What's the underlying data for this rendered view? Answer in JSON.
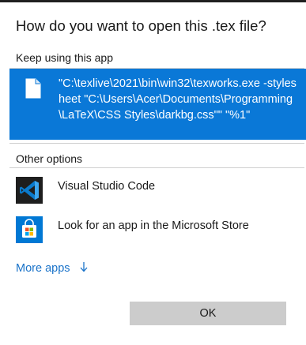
{
  "dialog": {
    "title": "How do you want to open this .tex file?"
  },
  "keep_section": {
    "header": "Keep using this app",
    "app": {
      "icon": "file-icon",
      "label": "\"C:\\texlive\\2021\\bin\\win32\\texworks.exe -stylesheet \"C:\\Users\\Acer\\Documents\\Programming\\LaTeX\\CSS Styles\\darkbg.css\"\" \"%1\""
    }
  },
  "other_section": {
    "header": "Other options",
    "apps": [
      {
        "icon": "vscode-icon",
        "label": "Visual Studio Code"
      },
      {
        "icon": "microsoft-store-icon",
        "label": "Look for an app in the Microsoft Store"
      }
    ]
  },
  "more_apps": {
    "label": "More apps",
    "icon": "arrow-down-icon"
  },
  "buttons": {
    "ok_label": "OK"
  },
  "colors": {
    "selection": "#0a78d7",
    "link": "#1a73c9",
    "button_bg": "#cccccc",
    "vscode_bg": "#1e1e1e",
    "vscode_blue": "#0a7acc",
    "store_bg": "#0078d4"
  }
}
